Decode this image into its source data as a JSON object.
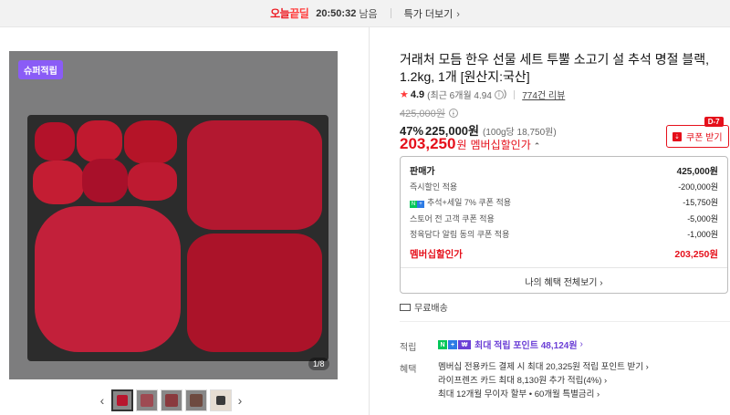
{
  "banner": {
    "deal_logo_a": "오늘",
    "deal_logo_b": "끝딜",
    "timer": "20:50:32",
    "timer_suffix": "남음",
    "more_deals": "특가 더보기",
    "more_deals_icon": "chevron-right-icon"
  },
  "gallery": {
    "badge": "슈퍼적립",
    "page_indicator": "1/8",
    "prev_icon": "chevron-left-icon",
    "next_icon": "chevron-right-icon",
    "thumbnail_count": 5,
    "active_thumbnail": 1
  },
  "product": {
    "title": "거래처 모듬 한우 선물 세트 투뿔 소고기 설 추석 명절 블랙, 1.2kg, 1개 [원산지:국산]",
    "rating": "4.9",
    "rating_recent": "(최근 6개월 4.94",
    "rating_info_icon": "info-icon",
    "reviews": "774건 리뷰",
    "original_price": "425,000원",
    "discount_rate": "47%",
    "discount_price": "225,000원",
    "unit_price": "(100g당 18,750원)",
    "member_price": "203,250",
    "member_price_unit": "원",
    "member_label": "멤버십할인가",
    "coupon_tag": "D-7",
    "coupon_button": "쿠폰 받기"
  },
  "price_breakdown": {
    "rows": [
      {
        "label": "판매가",
        "value": "425,000원"
      },
      {
        "label": "즉시할인 적용",
        "value": "-200,000원"
      },
      {
        "label": "추석+세일 7% 쿠폰 적용",
        "value": "-15,750원"
      },
      {
        "label": "스토어 전 고객 쿠폰 적용",
        "value": "-5,000원"
      },
      {
        "label": "정육담다 알림 동의 쿠폰 적용",
        "value": "-1,000원"
      }
    ],
    "total_label": "멤버십할인가",
    "total_value": "203,250원",
    "more": "나의 혜택 전체보기"
  },
  "shipping": {
    "label": "무료배송"
  },
  "points": {
    "label": "적립",
    "badge": "N",
    "text": "최대 적립 포인트 48,124원"
  },
  "benefits": {
    "label": "혜택",
    "items": [
      "멤버십 전용카드 결제 시 최대 20,325원 적립 포인트 받기",
      "라이프렌즈 카드 최대 8,130원 추가 적립(4%)",
      "최대 12개월 무이자 할부 • 60개월 특별금리"
    ]
  },
  "colors": {
    "accent_red": "#e5101b",
    "point_purple": "#6b3fd6",
    "naver_green": "#03c75a"
  }
}
